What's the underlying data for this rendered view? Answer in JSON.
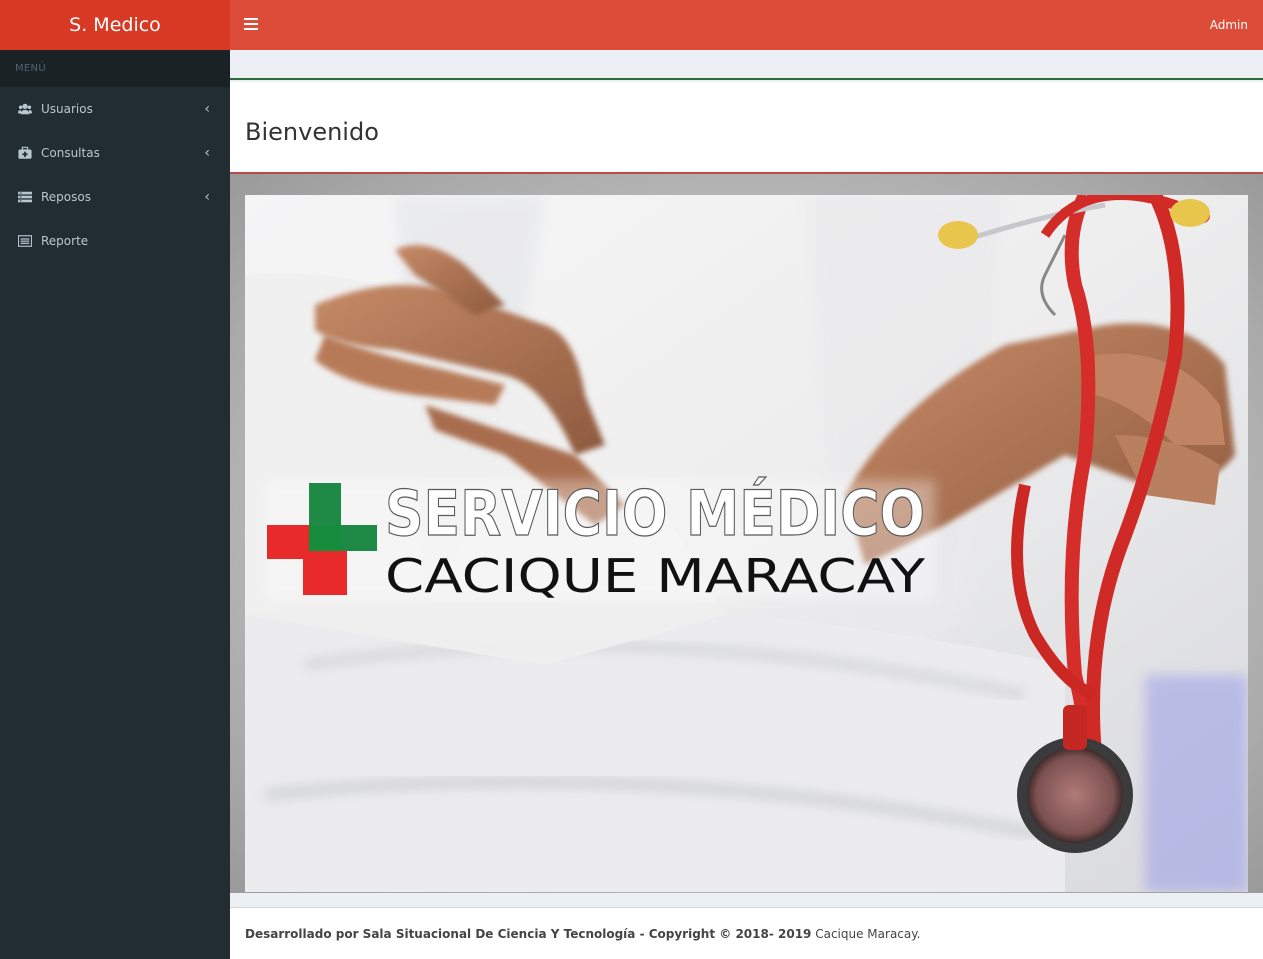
{
  "app": {
    "logo_text": "S. Medico"
  },
  "header": {
    "user_label": "Admin"
  },
  "sidebar": {
    "header": "MENÚ",
    "items": [
      {
        "label": "Usuarios",
        "icon": "users-icon",
        "has_submenu": true
      },
      {
        "label": "Consultas",
        "icon": "medkit-icon",
        "has_submenu": true
      },
      {
        "label": "Reposos",
        "icon": "list-icon",
        "has_submenu": true
      },
      {
        "label": "Reporte",
        "icon": "report-icon",
        "has_submenu": false
      }
    ]
  },
  "page": {
    "title": "Bienvenido",
    "banner": {
      "line1": "SERVICIO MÉDICO",
      "line2": "CACIQUE MARACAY"
    }
  },
  "footer": {
    "bold_text": "Desarrollado por Sala Situacional De Ciencia Y Tecnología - Copyright © 2018- 2019",
    "normal_text": " Cacique Maracay."
  },
  "colors": {
    "header": "#dd4b39",
    "logo_bg": "#d73925",
    "sidebar": "#222d32",
    "cross_red": "#e82a2a",
    "cross_green": "#1e8a46"
  }
}
